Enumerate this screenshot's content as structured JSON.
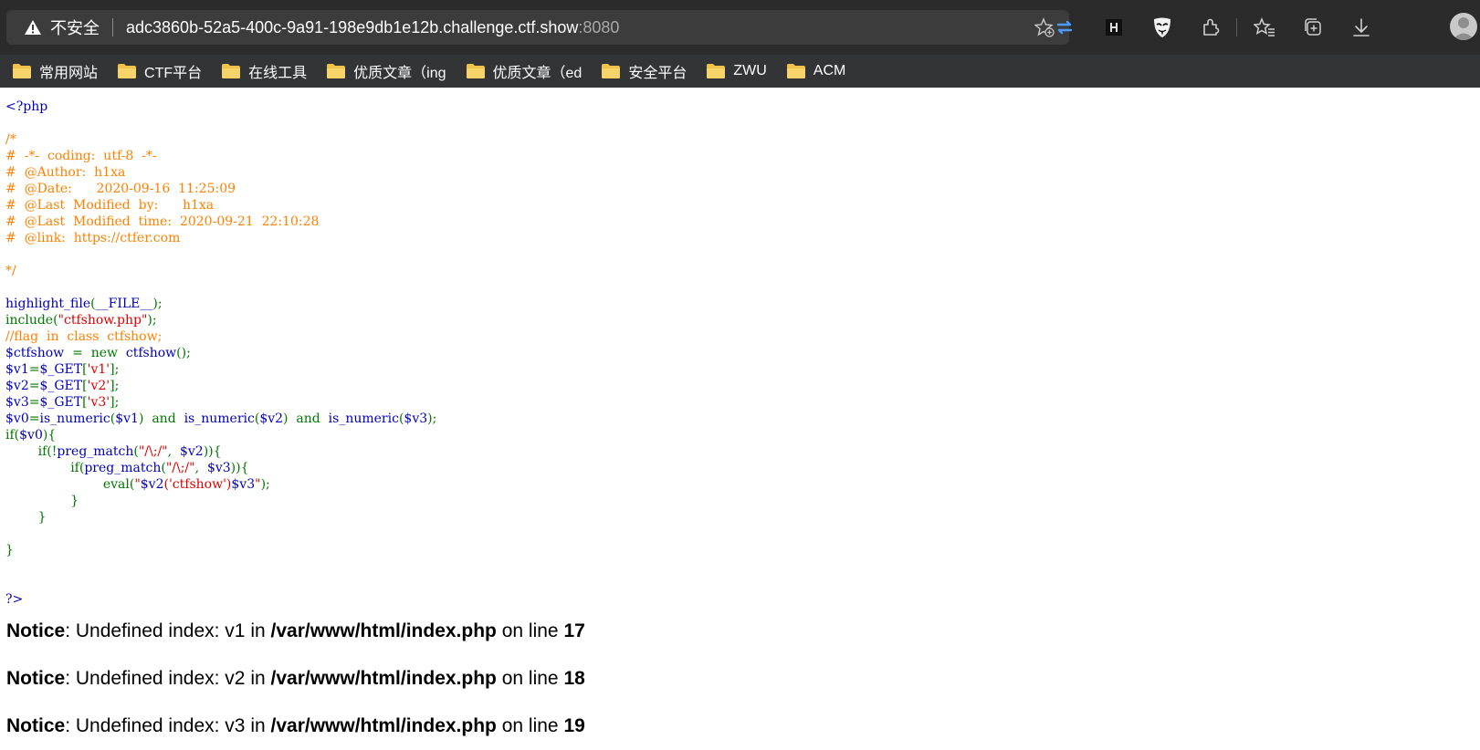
{
  "browser": {
    "security_label": "不安全",
    "url_host": "adc3860b-52a5-400c-9a91-198e9db1e12b.challenge.ctf.show",
    "url_port": ":8080",
    "bookmarks": [
      {
        "label": "常用网站"
      },
      {
        "label": "CTF平台"
      },
      {
        "label": "在线工具"
      },
      {
        "label": "优质文章（ing"
      },
      {
        "label": "优质文章（ed"
      },
      {
        "label": "安全平台"
      },
      {
        "label": "ZWU"
      },
      {
        "label": "ACM"
      }
    ],
    "colors": {
      "accent_blue": "#4c9aff",
      "folder": "#f0c24a"
    }
  },
  "code": {
    "open_tag": "<?php",
    "comment_block": "/*\n#  -*-  coding:  utf-8  -*-\n#  @Author:  h1xa\n#  @Date:      2020-09-16  11:25:09\n#  @Last  Modified  by:      h1xa\n#  @Last  Modified  time:  2020-09-21  22:10:28\n#  @link:  https://ctfer.com\n\n*/",
    "highlight_fn": "highlight_file",
    "file_const": "__FILE__",
    "include_kw": "include",
    "include_file": "\"ctfshow.php\"",
    "flag_comment": "//flag  in  class  ctfshow;",
    "ctfshow_var": "$ctfshow",
    "new_kw": "new",
    "ctfshow_call": "ctfshow",
    "v1": "$v1",
    "v2": "$v2",
    "v3": "$v3",
    "v0": "$v0",
    "get": "$_GET",
    "key_v1": "'v1'",
    "key_v2": "'v2'",
    "key_v3": "'v3'",
    "is_numeric": "is_numeric",
    "and_kw": "and",
    "if_kw": "if",
    "preg_match": "preg_match",
    "regex": "\"/\\;/\"",
    "eval_kw": "eval",
    "eval_open": "\"",
    "eval_mid": "('ctfshow')",
    "eval_close": "\"",
    "close_tag": "?>"
  },
  "notices": [
    {
      "label": "Notice",
      "text": ": Undefined index: v1 in ",
      "path": "/var/www/html/index.php",
      "on_line": " on line ",
      "line": "17"
    },
    {
      "label": "Notice",
      "text": ": Undefined index: v2 in ",
      "path": "/var/www/html/index.php",
      "on_line": " on line ",
      "line": "18"
    },
    {
      "label": "Notice",
      "text": ": Undefined index: v3 in ",
      "path": "/var/www/html/index.php",
      "on_line": " on line ",
      "line": "19"
    }
  ]
}
